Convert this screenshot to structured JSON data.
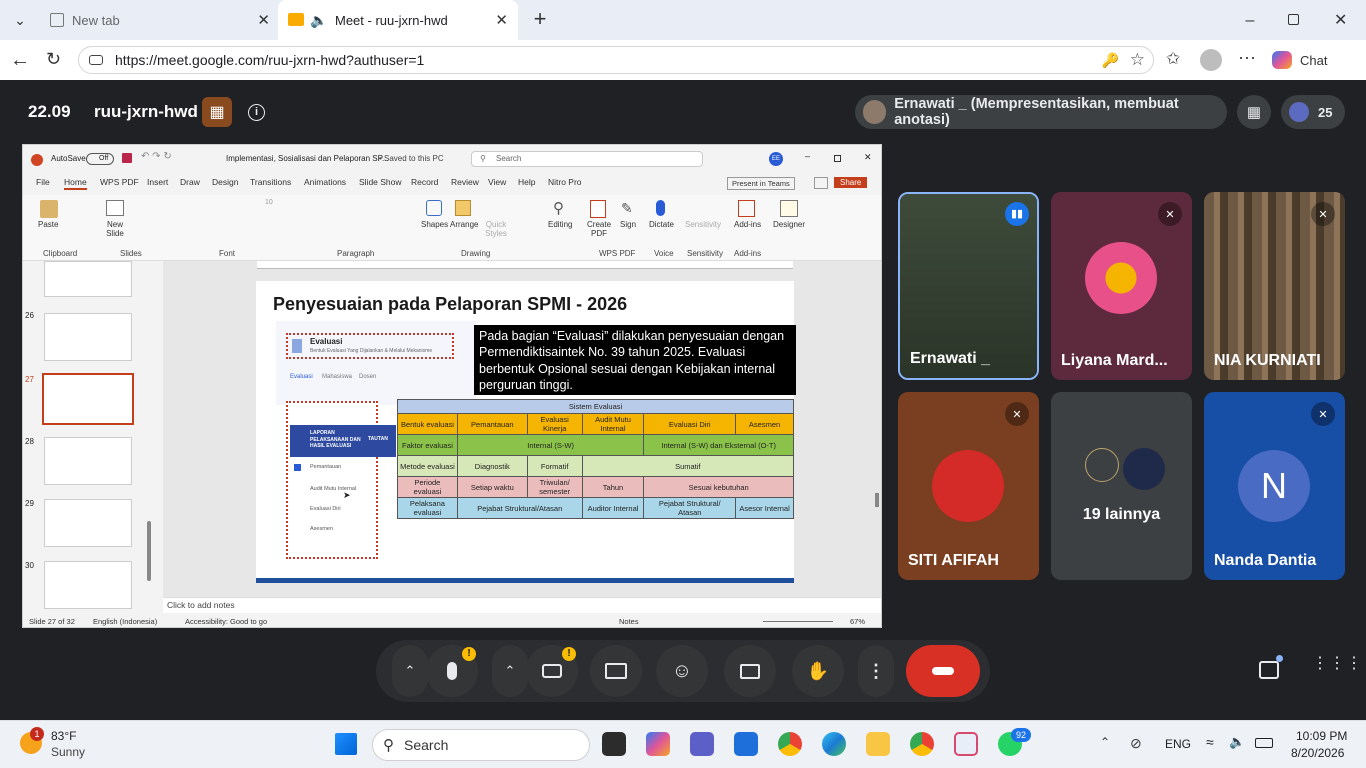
{
  "browser": {
    "tabs": [
      {
        "label": "New tab"
      },
      {
        "label": "Meet - ruu-jxrn-hwd"
      }
    ],
    "url": "https://meet.google.com/ruu-jxrn-hwd?authuser=1",
    "chat_label": "Chat"
  },
  "meet": {
    "time": "22.09",
    "meeting_code": "ruu-jxrn-hwd",
    "presenter_banner": "Ernawati _ (Mempresentasikan, membuat anotasi)",
    "participant_count": "25",
    "colors": {
      "leave": "#d93025",
      "warn": "#fbbc04",
      "self_border": "#8ab4f8"
    },
    "tiles": [
      {
        "name": "Ernawati _",
        "muted": false
      },
      {
        "name": "Liyana Mard...",
        "muted": true
      },
      {
        "name": "NIA KURNIATI",
        "muted": true
      },
      {
        "name": "SITI AFIFAH",
        "muted": true
      },
      {
        "name": "19 lainnya",
        "muted": false
      },
      {
        "name": "Nanda Dantia",
        "muted": true,
        "initial": "N"
      }
    ]
  },
  "ppt": {
    "autosave": "AutoSave",
    "autosave_state": "Off",
    "doc_title": "Implementasi, Sosialisasi dan Pelaporan SP...",
    "save_state": "• Saved to this PC",
    "search": "Search",
    "user_initials": "EE",
    "menu": [
      "File",
      "Home",
      "WPS PDF",
      "Insert",
      "Draw",
      "Design",
      "Transitions",
      "Animations",
      "Slide Show",
      "Record",
      "Review",
      "View",
      "Help",
      "Nitro Pro"
    ],
    "present_in_teams": "Present in Teams",
    "share": "Share",
    "ribbon_groups": [
      "Clipboard",
      "Slides",
      "Font",
      "Paragraph",
      "Drawing",
      "WPS PDF",
      "Voice",
      "Sensitivity",
      "Add-ins"
    ],
    "ribbon_buttons": [
      "Paste",
      "New Slide",
      "Shapes",
      "Arrange",
      "Quick Styles",
      "Editing",
      "Create PDF",
      "Sign",
      "Dictate",
      "Sensitivity",
      "Add-ins",
      "Designer"
    ],
    "font_size": "10",
    "thumbnails": [
      "26",
      "27",
      "28",
      "29",
      "30"
    ],
    "slide": {
      "title": "Penyesuaian pada Pelaporan SPMI - 2026",
      "inner_header": "Evaluasi",
      "inner_subtitle": "Bentuk Evaluasi Yang Dijalankan & Melalui Mekanisme",
      "inner_tabs": [
        "Evaluasi",
        "Mahasiswa",
        "Dosen"
      ],
      "callout": "Pada bagian “Evaluasi” dilakukan penyesuaian dengan Permendiktisaintek No. 39 tahun 2025. Evaluasi berbentuk Opsional sesuai dengan Kebijakan internal perguruan tinggi.",
      "panel_title": "LAPORAN PELAKSANAAN DAN HASIL EVALUASI",
      "panel_tag": "TAUTAN",
      "panel_items": [
        "Pemantauan",
        "Audit Mutu Internal",
        "Evaluasi Diri",
        "Asesmen"
      ],
      "table_title": "Sistem Evaluasi",
      "table_header": [
        "Bentuk evaluasi",
        "Pemantauan",
        "Evaluasi Kinerja",
        "Audit Mutu Internal",
        "Evaluasi Diri",
        "Asesmen"
      ],
      "row_faktor": [
        "Faktor evaluasi",
        "Internal (S-W)",
        "Internal (S-W) dan Eksternal (O-T)"
      ],
      "row_metode": [
        "Metode evaluasi",
        "Diagnostik",
        "Formatif",
        "Sumatif"
      ],
      "row_periode": [
        "Periode evaluasi",
        "Setiap waktu",
        "Triwulan/ semester",
        "Tahun",
        "Sesuai kebutuhan"
      ],
      "row_pelaksana": [
        "Pelaksana evaluasi",
        "Pejabat Struktural/Atasan",
        "Auditor Internal",
        "Pejabat Struktural/ Atasan",
        "Asesor Internal"
      ]
    },
    "notes_placeholder": "Click to add notes",
    "status": {
      "slide": "Slide 27 of 32",
      "language": "English (Indonesia)",
      "accessibility": "Accessibility: Good to go",
      "notes": "Notes",
      "zoom": "67%"
    }
  },
  "taskbar": {
    "weather_temp": "83°F",
    "weather_desc": "Sunny",
    "weather_badge": "1",
    "search": "Search",
    "whatsapp_badge": "92",
    "lang": "ENG",
    "time": "10:09 PM",
    "date": "8/20/2026"
  }
}
